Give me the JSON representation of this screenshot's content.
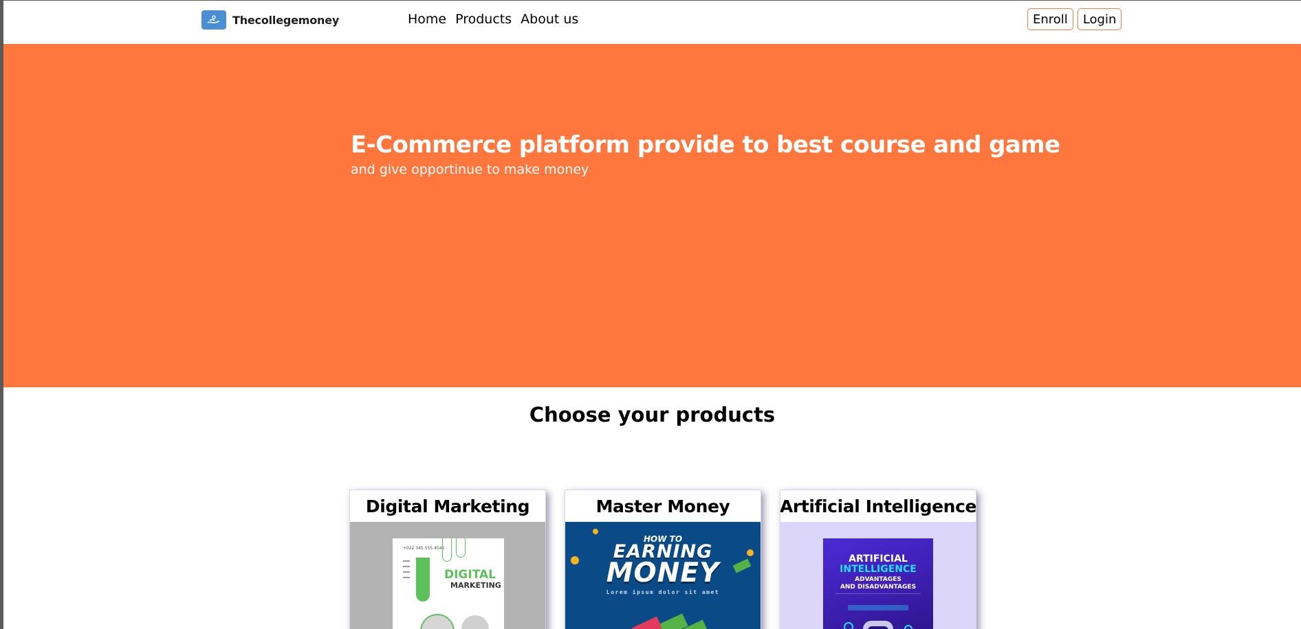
{
  "header": {
    "brand": "Thecollegemoney",
    "nav": [
      {
        "label": "Home"
      },
      {
        "label": "Products"
      },
      {
        "label": "About us"
      }
    ],
    "enroll_label": "Enroll",
    "login_label": "Login"
  },
  "hero": {
    "title": "E-Commerce platform provide to best course and game",
    "subtitle": "and give opportinue to make money"
  },
  "products": {
    "heading": "Choose your products",
    "cards": [
      {
        "title": "Digital Marketing",
        "poster": {
          "phone": "+022 345 555 4545",
          "line1": "DIGITAL",
          "line2": "MARKETING"
        }
      },
      {
        "title": "Master Money",
        "poster": {
          "line1": "HOW TO",
          "line2": "EARNING",
          "line3": "MONEY",
          "tagline": "Lorem ipsum dolor sit amet"
        }
      },
      {
        "title": "Artificial Intelligence",
        "poster": {
          "line1": "ARTIFICIAL",
          "line2": "INTELLIGENCE",
          "line3": "ADVANTAGES",
          "line4": "AND DISADVANTAGES"
        }
      }
    ]
  },
  "colors": {
    "accent": "#ff773d",
    "logo_bg": "#4a8fd6",
    "dm_green": "#5cc15b",
    "mm_blue": "#0a4a86",
    "ai_purple": "#4c2ad6",
    "ai_cyan": "#22e0ff"
  },
  "icons": {
    "logo": "hand-money-icon"
  }
}
